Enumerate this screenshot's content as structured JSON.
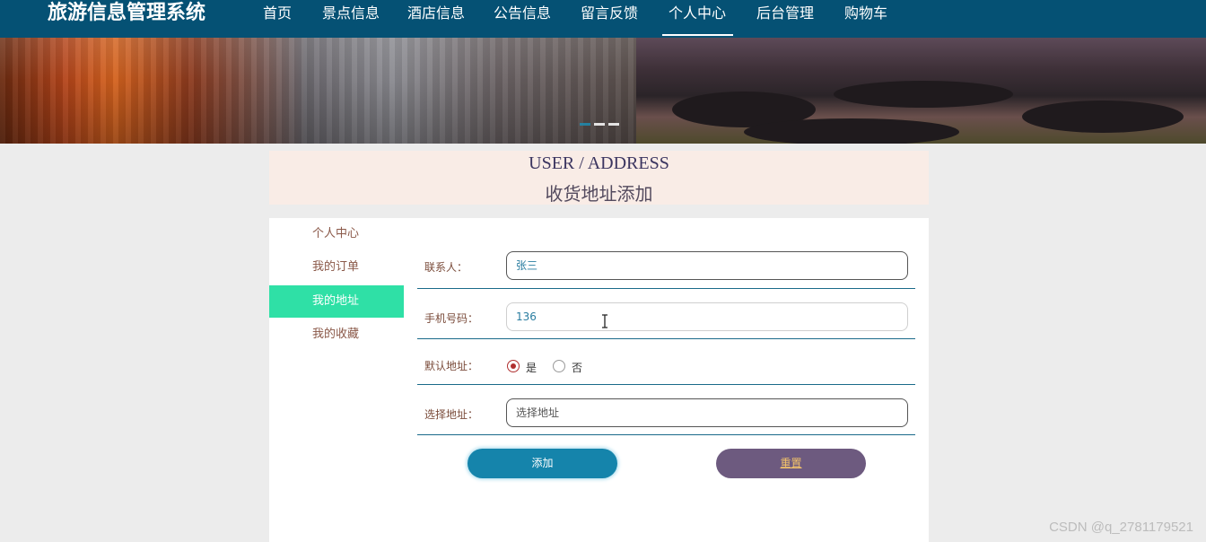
{
  "header": {
    "brand": "旅游信息管理系统",
    "nav": [
      {
        "label": "首页",
        "active": false
      },
      {
        "label": "景点信息",
        "active": false
      },
      {
        "label": "酒店信息",
        "active": false
      },
      {
        "label": "公告信息",
        "active": false
      },
      {
        "label": "留言反馈",
        "active": false
      },
      {
        "label": "个人中心",
        "active": true
      },
      {
        "label": "后台管理",
        "active": false
      },
      {
        "label": "购物车",
        "active": false
      }
    ]
  },
  "banner": {
    "slides": 3,
    "active_slide": 1
  },
  "title": {
    "en": "USER / ADDRESS",
    "cn": "收货地址添加"
  },
  "sidebar": {
    "items": [
      {
        "label": "个人中心",
        "active": false
      },
      {
        "label": "我的订单",
        "active": false
      },
      {
        "label": "我的地址",
        "active": true
      },
      {
        "label": "我的收藏",
        "active": false
      }
    ]
  },
  "form": {
    "contact_label": "联系人：",
    "contact_value": "张三",
    "phone_label": "手机号码：",
    "phone_value": "136",
    "default_label": "默认地址：",
    "default_yes": "是",
    "default_no": "否",
    "default_selected": "是",
    "address_label": "选择地址：",
    "address_value": "选择地址",
    "add_button": "添加",
    "reset_button": "重置"
  },
  "watermark": "CSDN @q_2781179521",
  "colors": {
    "nav_bg": "#055174",
    "active_side": "#2fe0a6",
    "add_btn": "#1584ab",
    "reset_btn": "#6d5a7f"
  }
}
